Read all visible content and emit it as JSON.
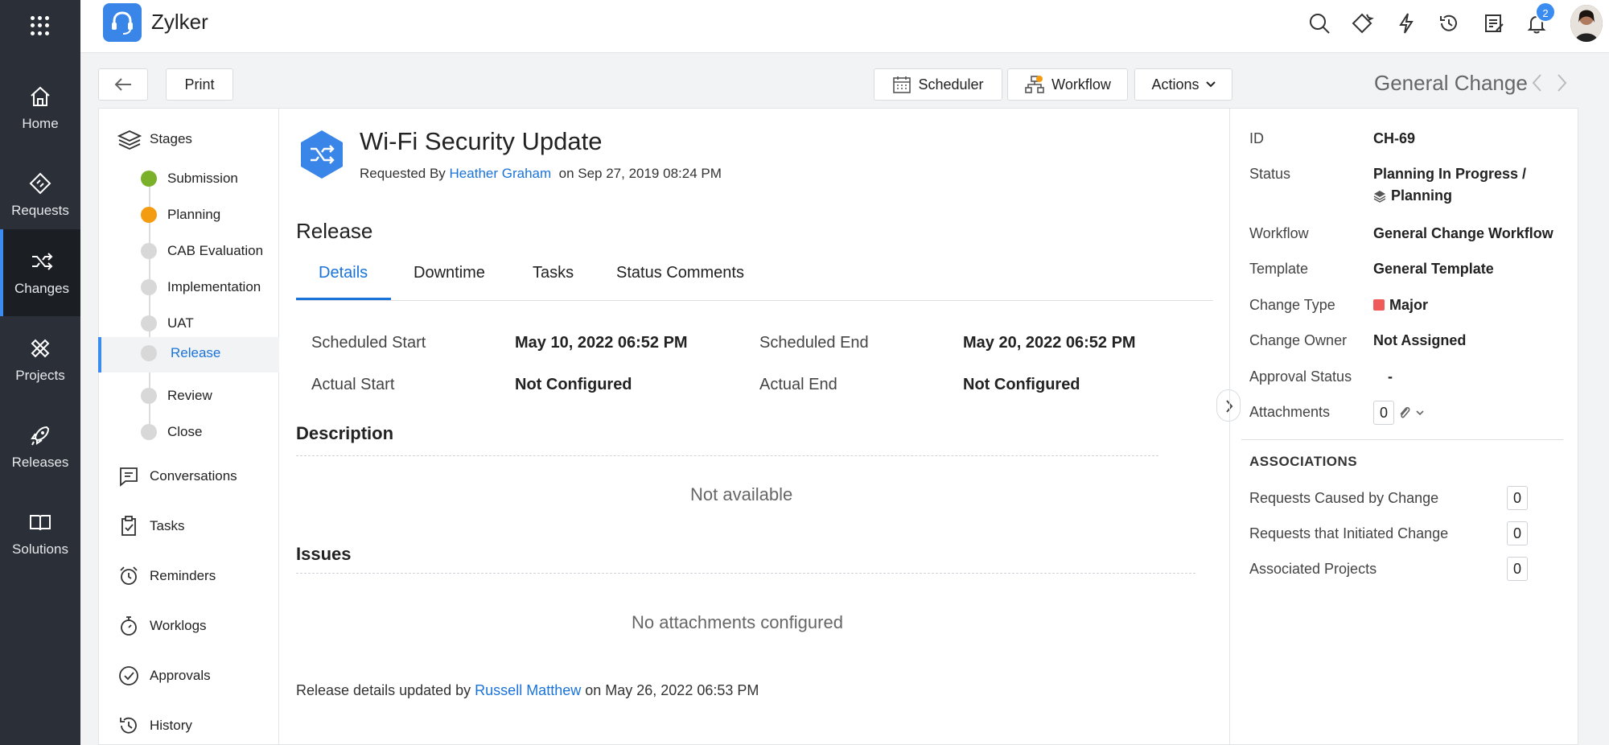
{
  "app": {
    "name": "Zylker",
    "notification_count": "2"
  },
  "nav": [
    {
      "label": "Home",
      "icon": "home-icon"
    },
    {
      "label": "Requests",
      "icon": "requests-icon"
    },
    {
      "label": "Changes",
      "icon": "changes-icon"
    },
    {
      "label": "Projects",
      "icon": "projects-icon"
    },
    {
      "label": "Releases",
      "icon": "releases-icon"
    },
    {
      "label": "Solutions",
      "icon": "solutions-icon"
    }
  ],
  "toolbar": {
    "print": "Print",
    "scheduler": "Scheduler",
    "workflow": "Workflow",
    "actions": "Actions",
    "page_type": "General Change"
  },
  "stages": {
    "heading": "Stages",
    "items": [
      {
        "label": "Submission",
        "color": "#7bb02a"
      },
      {
        "label": "Planning",
        "color": "#f39c12"
      },
      {
        "label": "CAB Evaluation",
        "color": "#d8d8d8"
      },
      {
        "label": "Implementation",
        "color": "#d8d8d8"
      },
      {
        "label": "UAT",
        "color": "#d8d8d8"
      },
      {
        "label": "Release",
        "color": "#d8d8d8"
      },
      {
        "label": "Review",
        "color": "#d8d8d8"
      },
      {
        "label": "Close",
        "color": "#d8d8d8"
      }
    ],
    "menu": [
      "Conversations",
      "Tasks",
      "Reminders",
      "Worklogs",
      "Approvals",
      "History"
    ]
  },
  "change": {
    "title": "Wi-Fi Security Update",
    "requested_prefix": "Requested By",
    "requester": "Heather Graham",
    "requested_on": "on Sep 27, 2019 08:24 PM"
  },
  "release": {
    "section_title": "Release",
    "tabs": [
      "Details",
      "Downtime",
      "Tasks",
      "Status Comments"
    ],
    "scheduled_start_label": "Scheduled Start",
    "scheduled_start": "May 10, 2022 06:52 PM",
    "scheduled_end_label": "Scheduled End",
    "scheduled_end": "May 20, 2022 06:52 PM",
    "actual_start_label": "Actual Start",
    "actual_start": "Not Configured",
    "actual_end_label": "Actual End",
    "actual_end": "Not Configured",
    "description_title": "Description",
    "description_empty": "Not available",
    "issues_title": "Issues",
    "issues_empty": "No attachments configured",
    "updated_prefix": "Release details updated by",
    "updated_by": "Russell Matthew",
    "updated_on": "on May 26, 2022 06:53 PM"
  },
  "details": {
    "id_label": "ID",
    "id": "CH-69",
    "status_label": "Status",
    "status_line1": "Planning In Progress /",
    "status_line2": "Planning",
    "workflow_label": "Workflow",
    "workflow": "General Change Workflow",
    "template_label": "Template",
    "template": "General Template",
    "change_type_label": "Change Type",
    "change_type": "Major",
    "change_type_color": "#ef5b5b",
    "owner_label": "Change Owner",
    "owner": "Not Assigned",
    "approval_label": "Approval Status",
    "approval": "-",
    "attachments_label": "Attachments",
    "attachments": "0"
  },
  "associations": {
    "heading": "ASSOCIATIONS",
    "items": [
      {
        "label": "Requests Caused by Change",
        "count": "0"
      },
      {
        "label": "Requests that Initiated Change",
        "count": "0"
      },
      {
        "label": "Associated Projects",
        "count": "0"
      }
    ]
  }
}
